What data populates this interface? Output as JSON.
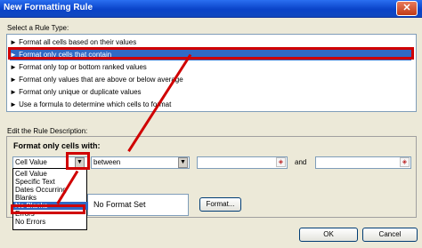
{
  "dialog": {
    "title": "New Formatting Rule",
    "close_label": "✕"
  },
  "rule_type": {
    "label": "Select a Rule Type:",
    "items": [
      "► Format all cells based on their values",
      "► Format only cells that contain",
      "► Format only top or bottom ranked values",
      "► Format only values that are above or below average",
      "► Format only unique or duplicate values",
      "► Use a formula to determine which cells to format"
    ],
    "selected_index": 1
  },
  "description": {
    "label": "Edit the Rule Description:",
    "heading": "Format only cells with:",
    "condition_value": "Cell Value",
    "operator_value": "between",
    "and_label": "and",
    "dropdown_options": [
      "Cell Value",
      "Specific Text",
      "Dates Occurring",
      "Blanks",
      "No Blanks",
      "Errors",
      "No Errors"
    ],
    "highlighted_option_index": 4,
    "preview_text": "No Format Set",
    "format_button": "Format..."
  },
  "footer": {
    "ok_label": "OK",
    "cancel_label": "Cancel"
  },
  "colors": {
    "selection": "#316ac5",
    "annotation": "#d00000",
    "title_bar": "#0a43c8"
  }
}
